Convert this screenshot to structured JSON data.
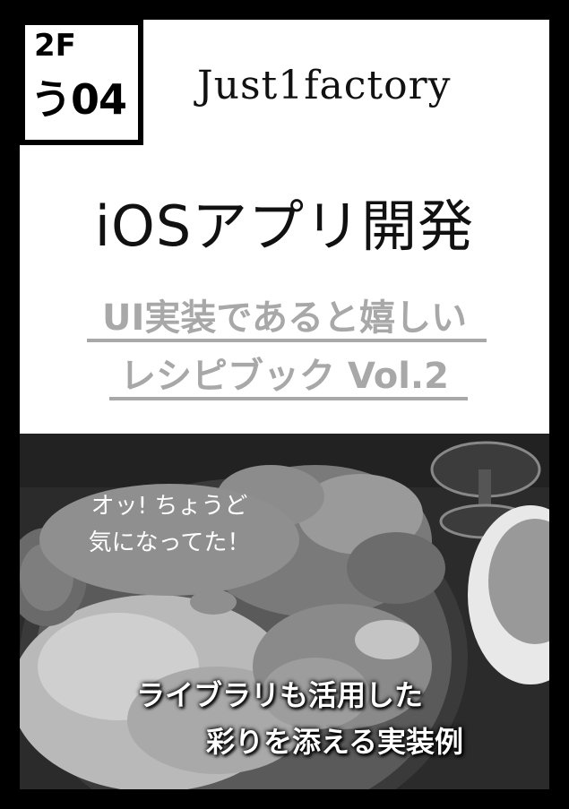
{
  "booth": {
    "floor": "2F",
    "number": "う04"
  },
  "circle": {
    "name": "Just1factory"
  },
  "title": {
    "main": "iOSアプリ開発",
    "subtitle_line1": "UI実装であると嬉しい",
    "subtitle_line2": "レシピブック Vol.2"
  },
  "speech_bubble": {
    "line1": "オッ! ちょうど",
    "line2": "気になってた！"
  },
  "tagline": {
    "line1": "ライブラリも活用した",
    "line2": "彩りを添える実装例"
  },
  "colors": {
    "frame": "#000000",
    "panel": "#ffffff",
    "subtitle": "#a8a8a8",
    "bubble": "#8f8f8f"
  }
}
